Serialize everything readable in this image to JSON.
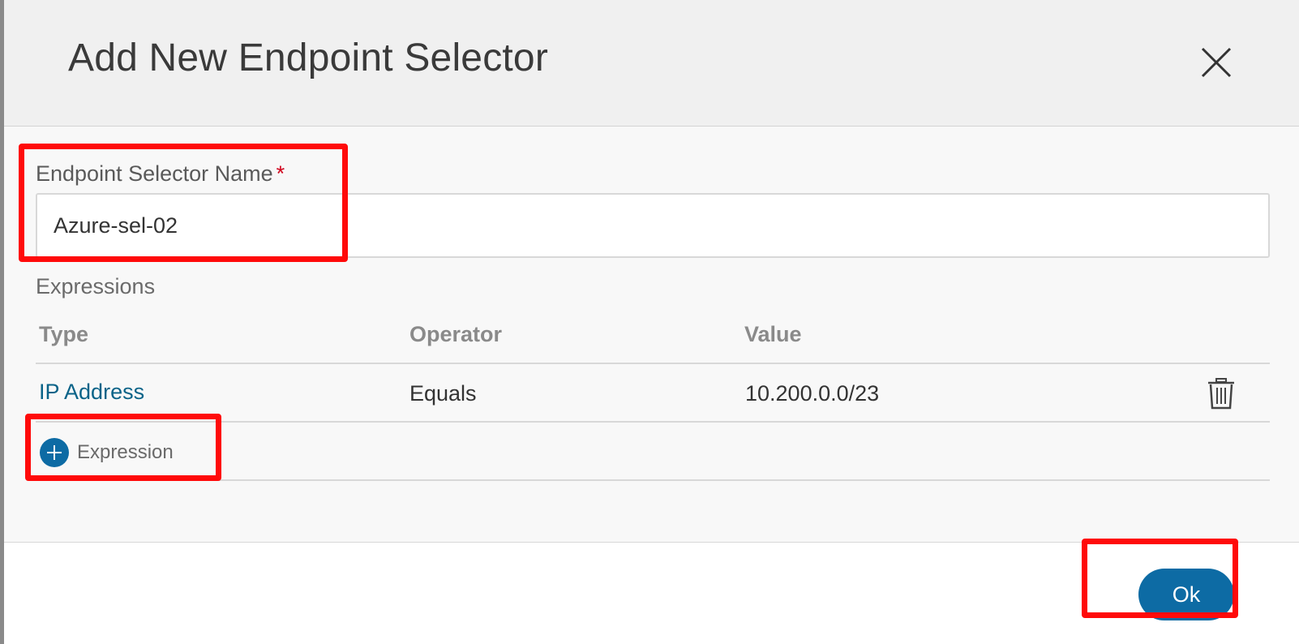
{
  "dialog": {
    "title": "Add New Endpoint Selector"
  },
  "form": {
    "name_label": "Endpoint Selector Name",
    "required_marker": "*",
    "name_value": "Azure-sel-02",
    "expressions_label": "Expressions"
  },
  "table": {
    "columns": [
      "Type",
      "Operator",
      "Value"
    ],
    "rows": [
      {
        "type": "IP Address",
        "operator": "Equals",
        "value": "10.200.0.0/23"
      }
    ]
  },
  "actions": {
    "add_expression_label": "Expression",
    "ok_label": "Ok"
  },
  "icons": {
    "close": "close-icon",
    "delete": "trash-icon",
    "add": "plus-circle-icon"
  },
  "colors": {
    "accent": "#0d6ba4",
    "link": "#0a6388",
    "required": "#d0021b",
    "annotation": "#ff0a0a"
  }
}
